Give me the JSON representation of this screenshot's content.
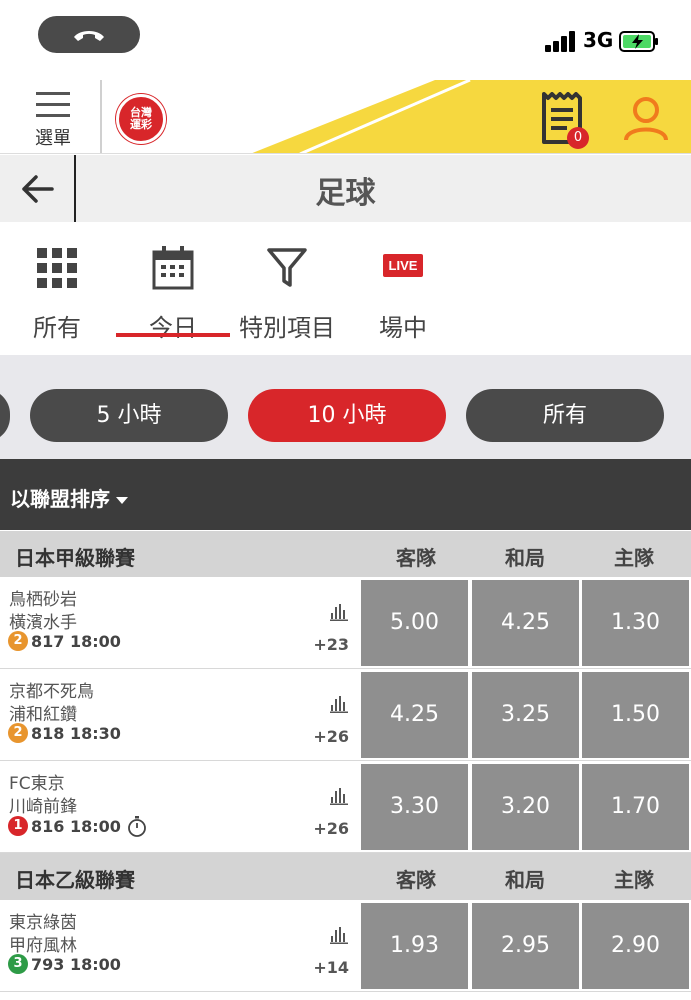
{
  "status_bar": {
    "network": "3G"
  },
  "header": {
    "menu_label": "選單",
    "logo_text": "台灣運彩",
    "betslip_count": "0"
  },
  "title_bar": {
    "title": "足球"
  },
  "filter_tabs": [
    {
      "label": "所有",
      "icon": "grid-icon"
    },
    {
      "label": "今日",
      "icon": "calendar-icon",
      "active": true
    },
    {
      "label": "特別項目",
      "icon": "filter-icon"
    },
    {
      "label": "場中",
      "icon": "live-badge",
      "badge_text": "LIVE"
    }
  ],
  "time_filters": [
    {
      "label": "5 小時",
      "active": false
    },
    {
      "label": "10 小時",
      "active": true
    },
    {
      "label": "所有",
      "active": false
    }
  ],
  "sort": {
    "label": "以聯盟排序"
  },
  "colors": {
    "accent": "#d8262a",
    "odds_bg": "#8f8f8f",
    "header_yellow": "#f6d83f"
  },
  "leagues": [
    {
      "name": "日本甲級聯賽",
      "columns": [
        "客隊",
        "和局",
        "主隊"
      ],
      "matches": [
        {
          "away": "鳥栖砂岩",
          "home": "橫濱水手",
          "badge": "2",
          "badge_color": "#e8952e",
          "code": "817",
          "time": "18:00",
          "more": "+23",
          "odds": [
            "5.00",
            "4.25",
            "1.30"
          ]
        },
        {
          "away": "京都不死鳥",
          "home": "浦和紅鑽",
          "badge": "2",
          "badge_color": "#e8952e",
          "code": "818",
          "time": "18:30",
          "more": "+26",
          "odds": [
            "4.25",
            "3.25",
            "1.50"
          ]
        },
        {
          "away": "FC東京",
          "home": "川崎前鋒",
          "badge": "1",
          "badge_color": "#d8262a",
          "code": "816",
          "time": "18:00",
          "more": "+26",
          "odds": [
            "3.30",
            "3.20",
            "1.70"
          ],
          "timer": true
        }
      ]
    },
    {
      "name": "日本乙級聯賽",
      "columns": [
        "客隊",
        "和局",
        "主隊"
      ],
      "matches": [
        {
          "away": "東京綠茵",
          "home": "甲府風林",
          "badge": "3",
          "badge_color": "#2e9b47",
          "code": "793",
          "time": "18:00",
          "more": "+14",
          "odds": [
            "1.93",
            "2.95",
            "2.90"
          ]
        }
      ]
    }
  ]
}
